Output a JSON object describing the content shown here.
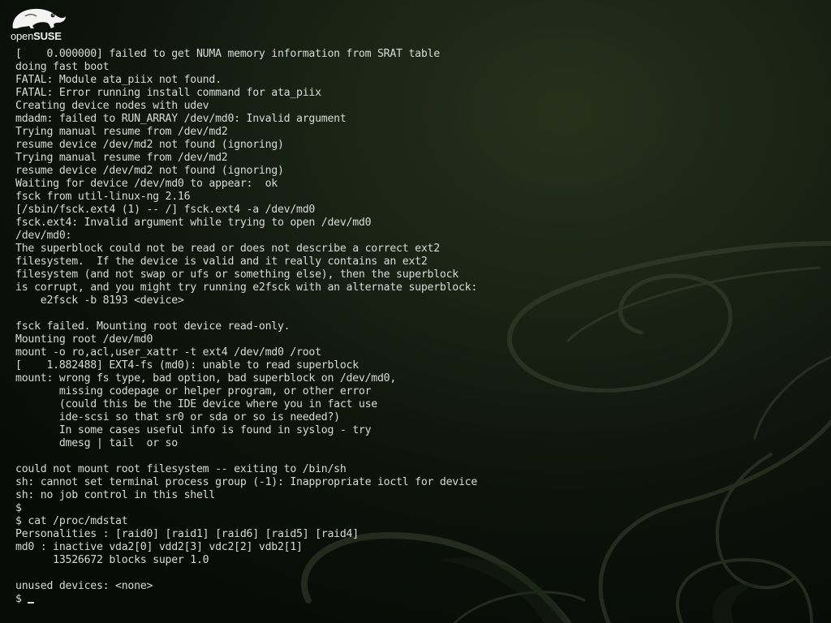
{
  "logo": {
    "icon": "opensuse-chameleon-icon",
    "word_prefix": "open",
    "word_suffix": "SUSE"
  },
  "console": {
    "lines": [
      "[    0.000000] failed to get NUMA memory information from SRAT table",
      "doing fast boot",
      "FATAL: Module ata_piix not found.",
      "FATAL: Error running install command for ata_piix",
      "Creating device nodes with udev",
      "mdadm: failed to RUN_ARRAY /dev/md0: Invalid argument",
      "Trying manual resume from /dev/md2",
      "resume device /dev/md2 not found (ignoring)",
      "Trying manual resume from /dev/md2",
      "resume device /dev/md2 not found (ignoring)",
      "Waiting for device /dev/md0 to appear:  ok",
      "fsck from util-linux-ng 2.16",
      "[/sbin/fsck.ext4 (1) -- /] fsck.ext4 -a /dev/md0",
      "fsck.ext4: Invalid argument while trying to open /dev/md0",
      "/dev/md0:",
      "The superblock could not be read or does not describe a correct ext2",
      "filesystem.  If the device is valid and it really contains an ext2",
      "filesystem (and not swap or ufs or something else), then the superblock",
      "is corrupt, and you might try running e2fsck with an alternate superblock:",
      "    e2fsck -b 8193 <device>",
      "",
      "fsck failed. Mounting root device read-only.",
      "Mounting root /dev/md0",
      "mount -o ro,acl,user_xattr -t ext4 /dev/md0 /root",
      "[    1.882488] EXT4-fs (md0): unable to read superblock",
      "mount: wrong fs type, bad option, bad superblock on /dev/md0,",
      "       missing codepage or helper program, or other error",
      "       (could this be the IDE device where you in fact use",
      "       ide-scsi so that sr0 or sda or so is needed?)",
      "       In some cases useful info is found in syslog - try",
      "       dmesg | tail  or so",
      "",
      "could not mount root filesystem -- exiting to /bin/sh",
      "sh: cannot set terminal process group (-1): Inappropriate ioctl for device",
      "sh: no job control in this shell",
      "$",
      "$ cat /proc/mdstat",
      "Personalities : [raid0] [raid1] [raid6] [raid5] [raid4]",
      "md0 : inactive vda2[0] vdd2[3] vdc2[2] vdb2[1]",
      "      13526672 blocks super 1.0",
      "",
      "unused devices: <none>"
    ],
    "prompt": "$ "
  }
}
